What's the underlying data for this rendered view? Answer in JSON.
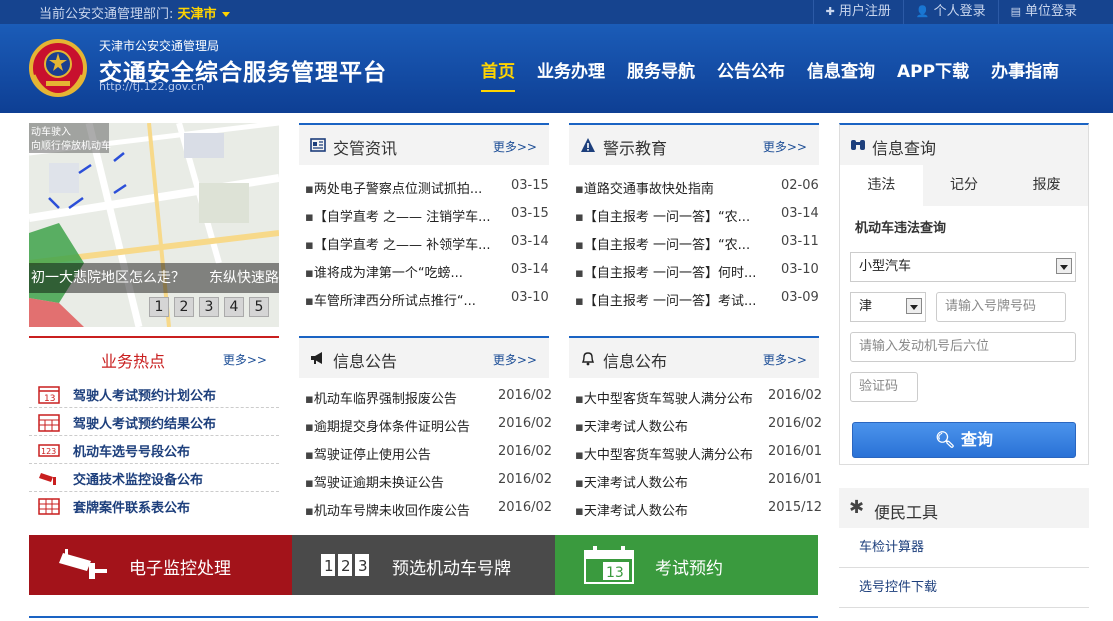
{
  "topbar": {
    "dept_label": "当前公安交通管理部门:",
    "dept_value": "天津市",
    "links": [
      {
        "label": "用户注册",
        "icon": "plus-icon"
      },
      {
        "label": "个人登录",
        "icon": "user-icon"
      },
      {
        "label": "单位登录",
        "icon": "building-icon"
      }
    ]
  },
  "header": {
    "org": "天津市公安交通管理局",
    "title": "交通安全综合服务管理平台",
    "url": "http://tj.122.gov.cn"
  },
  "nav": [
    "首页",
    "业务办理",
    "服务导航",
    "公告公布",
    "信息查询",
    "APP下载",
    "办事指南"
  ],
  "slider": {
    "captions": [
      "初一大悲院地区怎么走？",
      "东纵快速路"
    ],
    "map_text": [
      "动车驶入",
      "向顺行停放机动车"
    ],
    "pages": [
      "1",
      "2",
      "3",
      "4",
      "5"
    ]
  },
  "more_label": "更多>>",
  "traffic_news": {
    "title": "交管资讯",
    "items": [
      {
        "text": "两处电子警察点位测试抓拍...",
        "date": "03-15"
      },
      {
        "text": "【自学直考 之—— 注销学车...",
        "date": "03-15"
      },
      {
        "text": "【自学直考 之—— 补领学车...",
        "date": "03-14"
      },
      {
        "text": "谁将成为津第一个“吃螃...",
        "date": "03-14"
      },
      {
        "text": "车管所津西分所试点推行“...",
        "date": "03-10"
      }
    ]
  },
  "warning_edu": {
    "title": "警示教育",
    "items": [
      {
        "text": "道路交通事故快处指南",
        "date": "02-06"
      },
      {
        "text": "【自主报考 一问一答】“农...",
        "date": "03-14"
      },
      {
        "text": "【自主报考 一问一答】“农...",
        "date": "03-11"
      },
      {
        "text": "【自主报考 一问一答】何时...",
        "date": "03-10"
      },
      {
        "text": "【自主报考 一问一答】考试...",
        "date": "03-09"
      }
    ]
  },
  "hot": {
    "title": "业务热点",
    "items": [
      {
        "label": "驾驶人考试预约计划公布",
        "icon": "calendar-13-icon"
      },
      {
        "label": "驾驶人考试预约结果公布",
        "icon": "calendar-grid-icon"
      },
      {
        "label": "机动车选号号段公布",
        "icon": "number-plate-icon"
      },
      {
        "label": "交通技术监控设备公布",
        "icon": "camera-icon"
      },
      {
        "label": "套牌案件联系表公布",
        "icon": "table-icon"
      }
    ]
  },
  "info_notice": {
    "title": "信息公告",
    "items": [
      {
        "text": "机动车临界强制报废公告",
        "date": "2016/02"
      },
      {
        "text": "逾期提交身体条件证明公告",
        "date": "2016/02"
      },
      {
        "text": "驾驶证停止使用公告",
        "date": "2016/02"
      },
      {
        "text": "驾驶证逾期未换证公告",
        "date": "2016/02"
      },
      {
        "text": "机动车号牌未收回作废公告",
        "date": "2016/02"
      }
    ]
  },
  "info_publish": {
    "title": "信息公布",
    "items": [
      {
        "text": "大中型客货车驾驶人满分公布",
        "date": "2016/02"
      },
      {
        "text": "天津考试人数公布",
        "date": "2016/02"
      },
      {
        "text": "大中型客货车驾驶人满分公布",
        "date": "2016/01"
      },
      {
        "text": "天津考试人数公布",
        "date": "2016/01"
      },
      {
        "text": "天津考试人数公布",
        "date": "2015/12"
      }
    ]
  },
  "big_buttons": [
    {
      "label": "电子监控处理",
      "color": "#a3131a",
      "icon": "surveillance-camera-icon"
    },
    {
      "label": "预选机动车号牌",
      "color": "#4a4a4a",
      "icon": "number-123-icon"
    },
    {
      "label": "考试预约",
      "color": "#3a9a3e",
      "icon": "calendar-13-icon"
    }
  ],
  "query": {
    "title": "信息查询",
    "tabs": [
      "违法",
      "记分",
      "报废"
    ],
    "subtitle": "机动车违法查询",
    "vehicle_type": "小型汽车",
    "province": "津",
    "plate_placeholder": "请输入号牌号码",
    "engine_placeholder": "请输入发动机号后六位",
    "captcha_placeholder": "验证码",
    "button": "查询"
  },
  "tools": {
    "title": "便民工具",
    "items": [
      "车检计算器",
      "选号控件下载"
    ]
  },
  "colors": {
    "topbar": "#16448f",
    "header": "#1b5cb8",
    "accent": "#ffd400",
    "hot": "#c91f1f",
    "panel_border": "#1a63c3"
  }
}
